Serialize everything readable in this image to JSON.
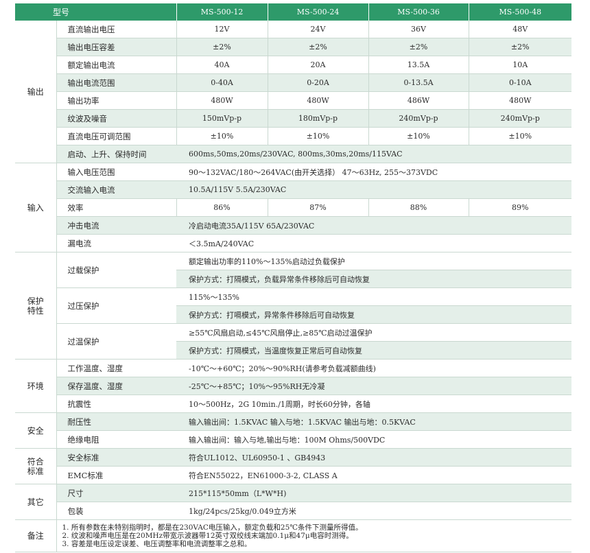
{
  "header": {
    "type_label": "型号",
    "models": [
      "MS-500-12",
      "MS-500-24",
      "MS-500-36",
      "MS-500-48"
    ]
  },
  "output": {
    "category": "输出",
    "rows": [
      {
        "param": "直流输出电压",
        "values": [
          "12V",
          "24V",
          "36V",
          "48V"
        ]
      },
      {
        "param": "输出电压容差",
        "values": [
          "±2%",
          "±2%",
          "±2%",
          "±2%"
        ]
      },
      {
        "param": "额定输出电流",
        "values": [
          "40A",
          "20A",
          "13.5A",
          "10A"
        ]
      },
      {
        "param": "输出电流范围",
        "values": [
          "0-40A",
          "0-20A",
          "0-13.5A",
          "0-10A"
        ]
      },
      {
        "param": "输出功率",
        "values": [
          "480W",
          "480W",
          "486W",
          "480W"
        ]
      },
      {
        "param": "纹波及噪音",
        "values": [
          "150mVp-p",
          "180mVp-p",
          "240mVp-p",
          "240mVp-p"
        ]
      },
      {
        "param": "直流电压可调范围",
        "values": [
          "±10%",
          "±10%",
          "±10%",
          "±10%"
        ]
      }
    ],
    "hold_param": "启动、上升、保持时间",
    "hold_value": "600ms,50ms,20ms/230VAC, 800ms,30ms,20ms/115VAC"
  },
  "input": {
    "category": "输入",
    "voltage_param": "输入电压范围",
    "voltage_value": "90～132VAC/180～264VAC(由开关选择） 47～63Hz, 255～373VDC",
    "current_param": "交流输入电流",
    "current_value": "10.5A/115V  5.5A/230VAC",
    "efficiency_param": "效率",
    "efficiency_values": [
      "86%",
      "87%",
      "88%",
      "89%"
    ],
    "inrush_param": "冲击电流",
    "inrush_value": "冷启动电流35A/115V  65A/230VAC",
    "leak_param": "漏电流",
    "leak_value": "＜3.5mA/240VAC"
  },
  "protection": {
    "category_line1": "保护",
    "category_line2": "特性",
    "overload_param": "过载保护",
    "overload_value1": "额定输出功率的110%～135%启动过负载保护",
    "overload_value2": "保护方式：打隔模式，负载异常条件移除后可自动恢复",
    "overvolt_param": "过压保护",
    "overvolt_value1": "115%～135%",
    "overvolt_value2": "保护方式：打嗝模式，异常条件移除后可自动恢复",
    "overtemp_param": "过温保护",
    "overtemp_value1": "≥55℃风扇启动,≤45℃风扇停止,≥85℃启动过温保护",
    "overtemp_value2": "保护方式：打隔模式，当温度恢复正常后可自动恢复"
  },
  "environment": {
    "category": "环境",
    "work_param": "工作温度、湿度",
    "work_value": "-10℃～+60℃；20%～90%RH(请参考负载减额曲线)",
    "storage_param": "保存温度、湿度",
    "storage_value": "-25℃～+85℃；10%～95%RH无冷凝",
    "vibration_param": "抗震性",
    "vibration_value": "10～500Hz，2G 10min./1周期，时长60分钟，各轴"
  },
  "safety": {
    "category": "安全",
    "withstand_param": "耐压性",
    "withstand_value": "输入输出间：1.5KVAC    输入与地：1.5KVAC    输出与地：0.5KVAC",
    "insulation_param": "绝缘电阻",
    "insulation_value": "输入输出间：输入与地,输出与地：100M Ohms/500VDC"
  },
  "compliance": {
    "category_line1": "符合",
    "category_line2": "标准",
    "safety_std_param": "安全标准",
    "safety_std_value": "符合UL1012、UL60950-1 、GB4943",
    "emc_param": "EMC标准",
    "emc_value": "符合EN55022，EN61000-3-2, CLASS A"
  },
  "other": {
    "category": "其它",
    "size_param": "尺寸",
    "size_value": "215*115*50mm（L*W*H)",
    "package_param": "包装",
    "package_value": "1kg/24pcs/25kg/0.049立方米"
  },
  "notes": {
    "category": "备注",
    "lines": [
      "1. 所有参数在未特别指明时，都是在230VAC电压输入，额定负载和25℃条件下测量所得值。",
      "2. 纹波和噪声电压是在20MHz带宽示波器带12英寸双绞线末端加0.1μ和47μ电容时测得。",
      "3. 容差是电压设定误差、电压调整率和电流调整率之总和。"
    ]
  },
  "colors": {
    "header_green": "#2e9a6a",
    "row_tint": "#e4efe9",
    "grid_line": "#c9d8d0"
  }
}
